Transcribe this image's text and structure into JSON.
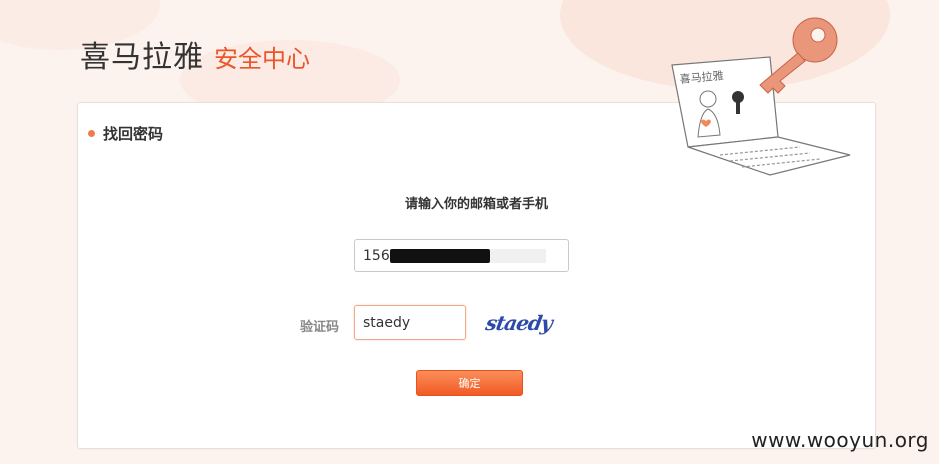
{
  "brand": {
    "name": "喜马拉雅",
    "subtitle": "安全中心"
  },
  "section": {
    "title": "找回密码"
  },
  "form": {
    "prompt": "请输入你的邮箱或者手机",
    "account_value_visible": "156",
    "captcha_label": "验证码",
    "captcha_value": "staedy",
    "captcha_image_text": "staedy",
    "submit_label": "确定"
  },
  "illustration": {
    "screen_text": "喜马拉雅"
  },
  "watermark": "www.wooyun.org",
  "colors": {
    "accent": "#e8562a",
    "button": "#f15a24",
    "captcha": "#2d4aa8"
  }
}
